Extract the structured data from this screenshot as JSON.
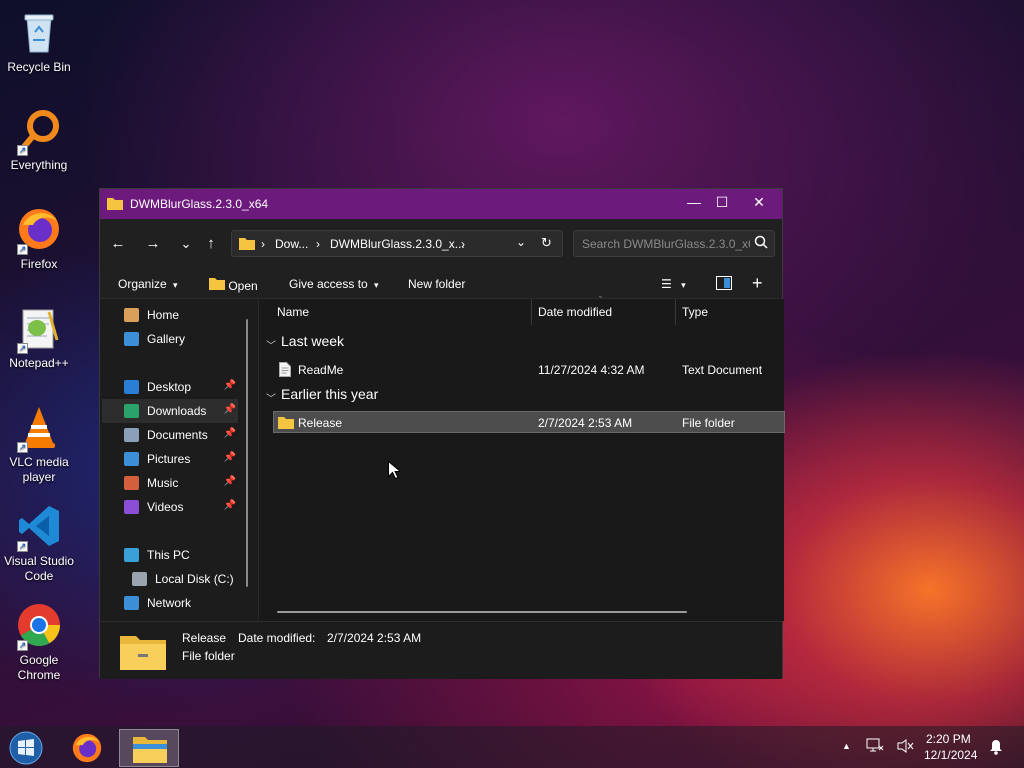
{
  "desktop": {
    "icons": [
      {
        "label": "Recycle Bin"
      },
      {
        "label": "Everything"
      },
      {
        "label": "Firefox"
      },
      {
        "label": "Notepad++"
      },
      {
        "label": "VLC media player"
      },
      {
        "label": "Visual Studio Code"
      },
      {
        "label": "Google Chrome"
      }
    ]
  },
  "window": {
    "title": "DWMBlurGlass.2.3.0_x64",
    "controls": {
      "minimize": "—",
      "maximize": "☐",
      "close": "✕"
    },
    "nav": {
      "back": "←",
      "forward": "→",
      "recent": "⌄",
      "up": "↑"
    },
    "address": {
      "crumbs": [
        "Dow...",
        "DWMBlurGlass.2.3.0_x..."
      ],
      "separator": "›"
    },
    "search": {
      "placeholder": "Search DWMBlurGlass.2.3.0_x64"
    },
    "toolbar": {
      "organize": "Organize",
      "open": "Open",
      "give_access": "Give access to",
      "new_folder": "New folder"
    },
    "sidebar": {
      "items": [
        {
          "label": "Home",
          "color": "#d9a05b",
          "pinned": false
        },
        {
          "label": "Gallery",
          "color": "#3a8fd6",
          "pinned": false
        },
        {
          "label": "Desktop",
          "color": "#2a7fd4",
          "pinned": true
        },
        {
          "label": "Downloads",
          "color": "#2aa36b",
          "pinned": true
        },
        {
          "label": "Documents",
          "color": "#8aa0b8",
          "pinned": true
        },
        {
          "label": "Pictures",
          "color": "#3a8fd6",
          "pinned": true
        },
        {
          "label": "Music",
          "color": "#d35f3c",
          "pinned": true
        },
        {
          "label": "Videos",
          "color": "#8b4fd6",
          "pinned": true
        },
        {
          "label": "This PC",
          "color": "#3aa0d8",
          "pinned": false
        },
        {
          "label": "Local Disk (C:)",
          "color": "#9aa4ae",
          "pinned": false
        },
        {
          "label": "Network",
          "color": "#3a8fd6",
          "pinned": false
        }
      ]
    },
    "columns": {
      "name": "Name",
      "date": "Date modified",
      "type": "Type"
    },
    "groups": [
      {
        "label": "Last week",
        "files": [
          {
            "name": "ReadMe",
            "date": "11/27/2024 4:32 AM",
            "type": "Text Document"
          }
        ]
      },
      {
        "label": "Earlier this year",
        "files": [
          {
            "name": "Release",
            "date": "2/7/2024 2:53 AM",
            "type": "File folder"
          }
        ]
      }
    ],
    "details": {
      "name": "Release",
      "date_label": "Date modified:",
      "date_value": "2/7/2024 2:53 AM",
      "type": "File folder"
    }
  },
  "taskbar": {
    "time": "2:20 PM",
    "date": "12/1/2024",
    "tray_arrow": "▲"
  }
}
